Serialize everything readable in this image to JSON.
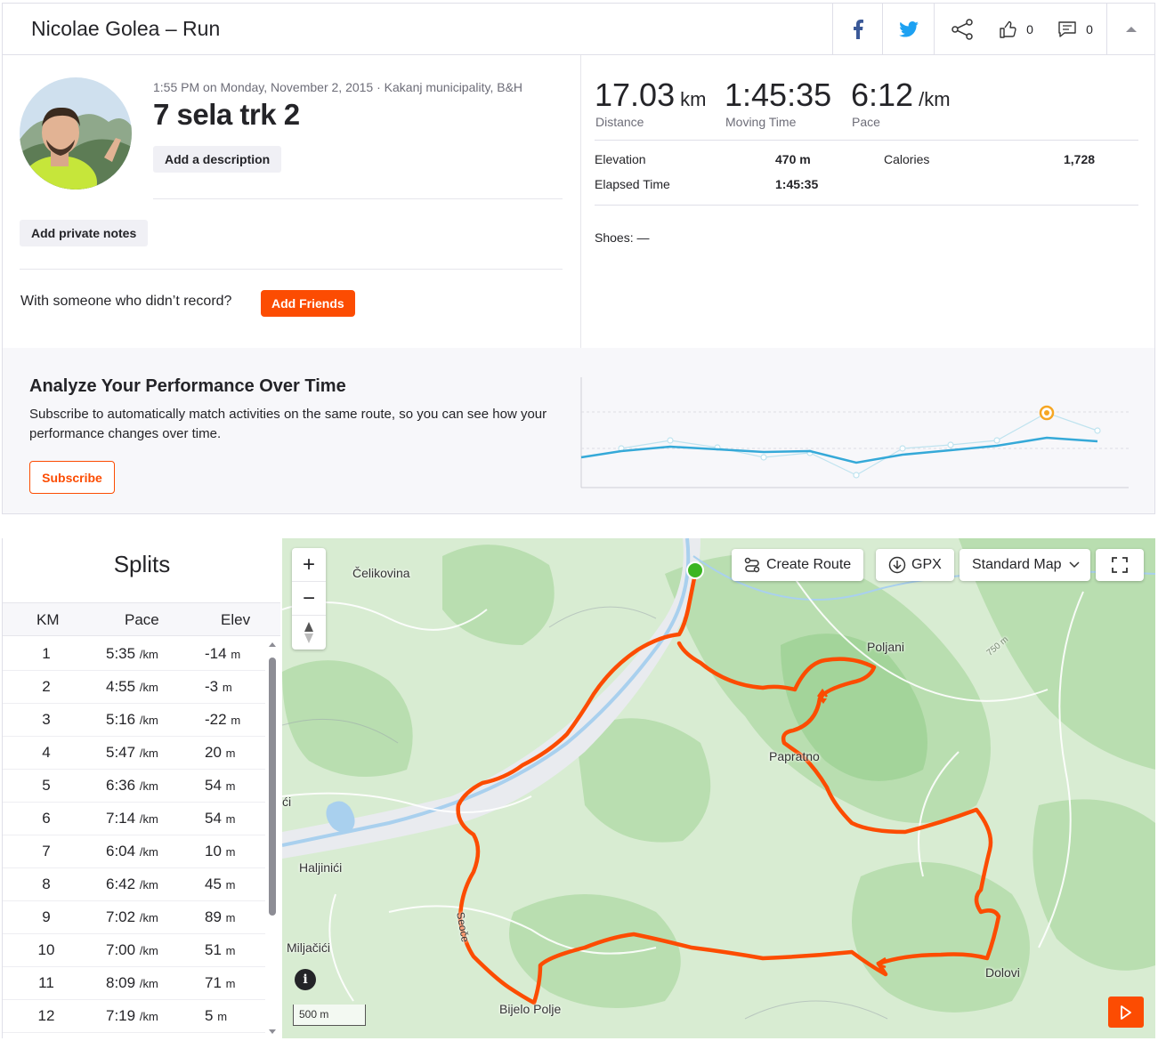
{
  "header": {
    "title": "Nicolae Golea – Run",
    "kudos_count": "0",
    "comments_count": "0"
  },
  "activity": {
    "meta": "1:55 PM on Monday, November 2, 2015 · Kakanj municipality, B&H",
    "name": "7 sela trk 2",
    "add_description": "Add a description",
    "add_private_notes": "Add private notes",
    "friends_question": "With someone who didn’t record?",
    "add_friends": "Add Friends"
  },
  "stats": {
    "distance_value": "17.03",
    "distance_unit": "km",
    "distance_label": "Distance",
    "moving_time_value": "1:45:35",
    "moving_time_label": "Moving Time",
    "pace_value": "6:12",
    "pace_unit": "/km",
    "pace_label": "Pace",
    "elevation_label": "Elevation",
    "elevation_value": "470 m",
    "calories_label": "Calories",
    "calories_value": "1,728",
    "elapsed_label": "Elapsed Time",
    "elapsed_value": "1:45:35",
    "shoes": "Shoes: —"
  },
  "analyze": {
    "title": "Analyze Your Performance Over Time",
    "text": "Subscribe to automatically match activities on the same route, so you can see how your performance changes over time.",
    "subscribe": "Subscribe"
  },
  "splits": {
    "title": "Splits",
    "col_km": "KM",
    "col_pace": "Pace",
    "col_elev": "Elev",
    "pace_unit": "/km",
    "elev_unit": "m",
    "rows": [
      {
        "km": "1",
        "pace": "5:35",
        "elev": "-14"
      },
      {
        "km": "2",
        "pace": "4:55",
        "elev": "-3"
      },
      {
        "km": "3",
        "pace": "5:16",
        "elev": "-22"
      },
      {
        "km": "4",
        "pace": "5:47",
        "elev": "20"
      },
      {
        "km": "5",
        "pace": "6:36",
        "elev": "54"
      },
      {
        "km": "6",
        "pace": "7:14",
        "elev": "54"
      },
      {
        "km": "7",
        "pace": "6:04",
        "elev": "10"
      },
      {
        "km": "8",
        "pace": "6:42",
        "elev": "45"
      },
      {
        "km": "9",
        "pace": "7:02",
        "elev": "89"
      },
      {
        "km": "10",
        "pace": "7:00",
        "elev": "51"
      },
      {
        "km": "11",
        "pace": "8:09",
        "elev": "71"
      },
      {
        "km": "12",
        "pace": "7:19",
        "elev": "5"
      }
    ]
  },
  "map": {
    "create_route": "Create Route",
    "gpx": "GPX",
    "map_type": "Standard Map",
    "scale": "500 m",
    "contour": "750 m",
    "places": {
      "celikovina": "Čelikovina",
      "poljani": "Poljani",
      "papratno": "Papratno",
      "ci": "ći",
      "haljinici": "Haljinići",
      "miljacici": "Miljačići",
      "seoce": "Seoče",
      "bijelo_polje": "Bijelo Polje",
      "dolovi": "Dolovi"
    },
    "colors": {
      "route": "#fc4c02",
      "start": "#3cb521",
      "land": "#d8ecd2",
      "forest": "#b9deb0",
      "water": "#a9d0ee"
    }
  }
}
